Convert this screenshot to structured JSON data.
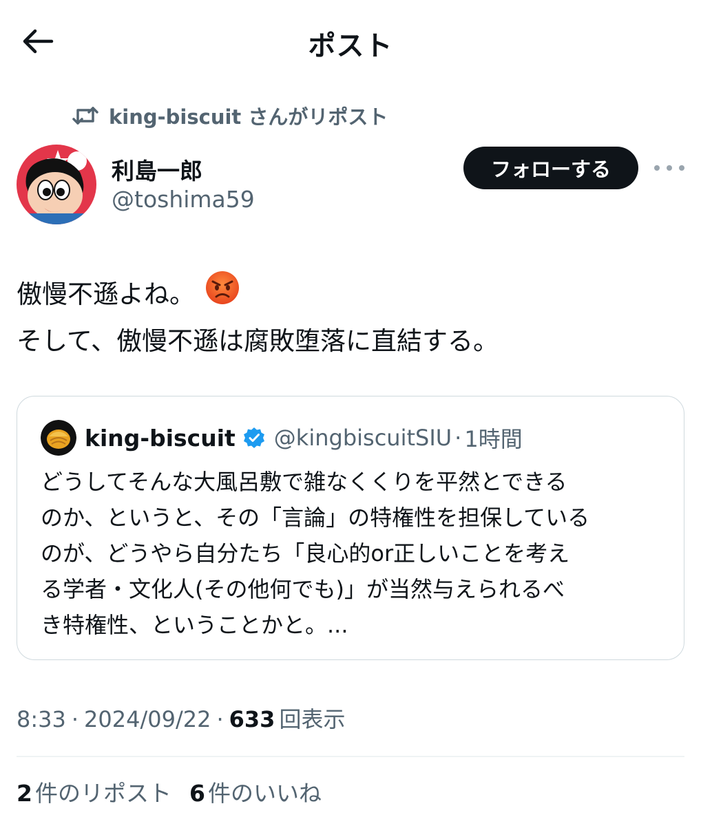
{
  "header": {
    "title": "ポスト"
  },
  "repost": {
    "text": "king-biscuit さんがリポスト"
  },
  "author": {
    "display_name": "利島一郎",
    "handle": "@toshima59",
    "follow_label": "フォローする"
  },
  "tweet": {
    "line1": "傲慢不遜よね。",
    "line2": "そして、傲慢不遜は腐敗堕落に直結する。"
  },
  "quote": {
    "name": "king-biscuit",
    "handle": "@kingbiscuitSIU",
    "separator": "·",
    "time": "1時間",
    "lines": [
      "どうしてそんな大風呂敷で雑なくくりを平然とできる",
      "のか、というと、その「言論」の特権性を担保している",
      "のが、どうやら自分たち「良心的or正しいことを考え",
      "る学者・文化人(その他何でも)」が当然与えられるべ",
      "き特権性、ということかと。..."
    ]
  },
  "meta": {
    "time": "8:33",
    "sep1": "·",
    "date": "2024/09/22",
    "sep2": "·",
    "views": "633",
    "views_label": "回表示"
  },
  "stats": {
    "reposts": "2",
    "reposts_label": "件のリポスト",
    "likes": "6",
    "likes_label": "件のいいね"
  },
  "colors": {
    "text": "#0f1419",
    "secondary": "#536471",
    "border": "#cfd9de",
    "verified": "#1d9bf0",
    "button": "#0f1419"
  },
  "icons": {
    "back": "arrow-left-icon",
    "repost": "repost-icon",
    "more": "more-dots-icon",
    "verified": "verified-badge-icon",
    "emoji": "angry-face-emoji"
  }
}
